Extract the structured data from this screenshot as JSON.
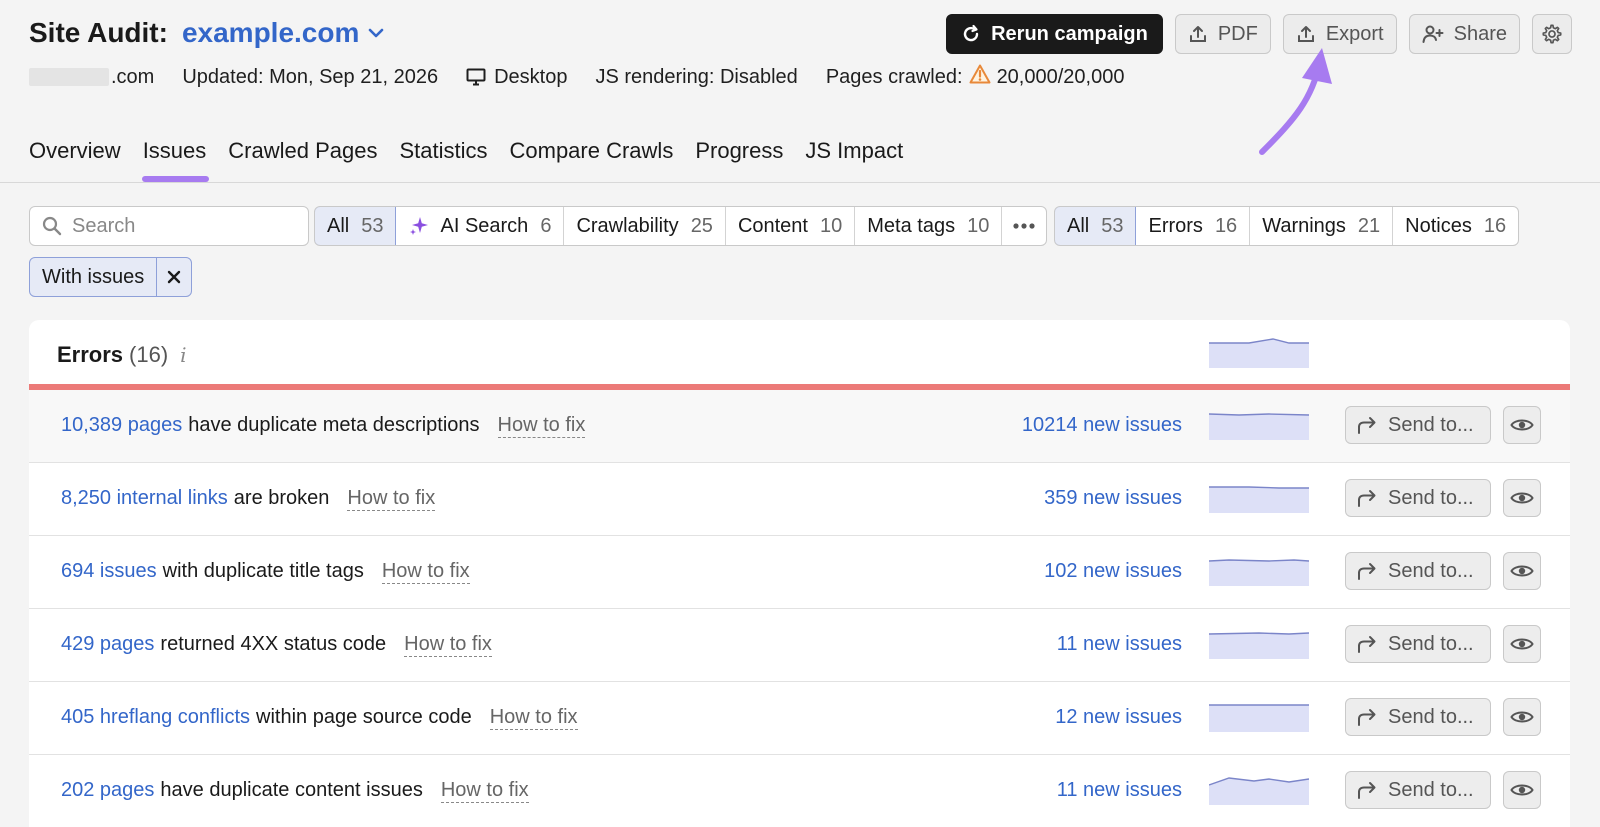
{
  "header": {
    "title_label": "Site Audit:",
    "domain": "example.com",
    "site_suffix": ".com",
    "updated": "Updated: Mon, Sep 21, 2026",
    "device": "Desktop",
    "js_rendering": "JS rendering: Disabled",
    "pages_crawled_label": "Pages crawled:",
    "pages_crawled_value": "20,000/20,000"
  },
  "actions": {
    "rerun": "Rerun campaign",
    "pdf": "PDF",
    "export": "Export",
    "share": "Share"
  },
  "tabs": [
    {
      "label": "Overview"
    },
    {
      "label": "Issues"
    },
    {
      "label": "Crawled Pages"
    },
    {
      "label": "Statistics"
    },
    {
      "label": "Compare Crawls"
    },
    {
      "label": "Progress"
    },
    {
      "label": "JS Impact"
    }
  ],
  "search": {
    "placeholder": "Search"
  },
  "category_filters": [
    {
      "label": "All",
      "count": "53"
    },
    {
      "label": "AI Search",
      "count": "6"
    },
    {
      "label": "Crawlability",
      "count": "25"
    },
    {
      "label": "Content",
      "count": "10"
    },
    {
      "label": "Meta tags",
      "count": "10"
    }
  ],
  "severity_filters": [
    {
      "label": "All",
      "count": "53"
    },
    {
      "label": "Errors",
      "count": "16"
    },
    {
      "label": "Warnings",
      "count": "21"
    },
    {
      "label": "Notices",
      "count": "16"
    }
  ],
  "active_chip": {
    "label": "With issues"
  },
  "errors_section": {
    "title": "Errors",
    "count": "(16)",
    "info_glyph": "i",
    "rows": [
      {
        "link": "10,389 pages",
        "rest": "have duplicate meta descriptions",
        "fix": "How to fix",
        "new": "10214 new issues",
        "send": "Send to..."
      },
      {
        "link": "8,250 internal links",
        "rest": "are broken",
        "fix": "How to fix",
        "new": "359 new issues",
        "send": "Send to..."
      },
      {
        "link": "694 issues",
        "rest": "with duplicate title tags",
        "fix": "How to fix",
        "new": "102 new issues",
        "send": "Send to..."
      },
      {
        "link": "429 pages",
        "rest": "returned 4XX status code",
        "fix": "How to fix",
        "new": "11 new issues",
        "send": "Send to..."
      },
      {
        "link": "405 hreflang conflicts",
        "rest": "within page source code",
        "fix": "How to fix",
        "new": "12 new issues",
        "send": "Send to..."
      },
      {
        "link": "202 pages",
        "rest": "have duplicate content issues",
        "fix": "How to fix",
        "new": "11 new issues",
        "send": "Send to..."
      }
    ]
  },
  "colors": {
    "brand_blue": "#3366c9",
    "error_red": "#ec7a78",
    "active_tab_purple": "#a77bf0",
    "sparkline_fill": "#dde0f7",
    "sparkline_stroke": "#7b85c9"
  }
}
